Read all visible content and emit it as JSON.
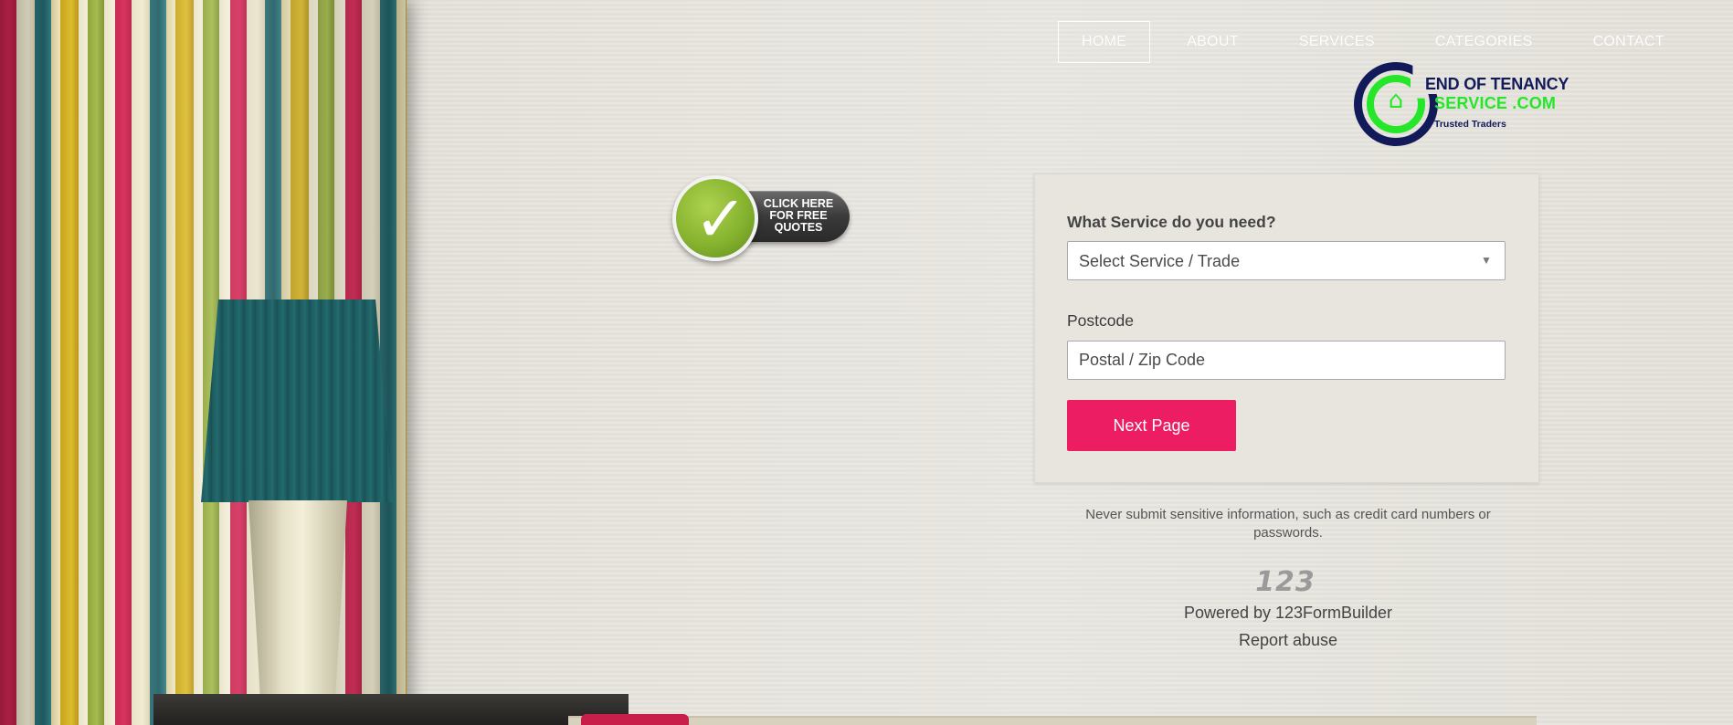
{
  "nav": {
    "items": [
      {
        "label": "HOME",
        "active": true
      },
      {
        "label": "ABOUT",
        "active": false
      },
      {
        "label": "SERVICES",
        "active": false
      },
      {
        "label": "CATEGORIES",
        "active": false
      },
      {
        "label": "CONTACT",
        "active": false
      }
    ]
  },
  "logo": {
    "line1": "END OF TENANCY",
    "line2": "SERVICE .COM",
    "line3": "Trusted Traders"
  },
  "badge": {
    "line1": "CLICK HERE",
    "line2": "FOR FREE",
    "line3": "QUOTES"
  },
  "form": {
    "service_label": "What Service do you need?",
    "service_selected": "Select Service / Trade",
    "postcode_label": "Postcode",
    "postcode_placeholder": "Postal / Zip Code",
    "postcode_value": "",
    "next_button": "Next Page"
  },
  "footer": {
    "note": "Never submit sensitive information, such as credit card numbers or passwords.",
    "logo_text": "123",
    "powered_by": "Powered by 123FormBuilder",
    "report_abuse": "Report abuse"
  },
  "colors": {
    "accent": "#ec1d63",
    "logo_navy": "#131a5a",
    "logo_green": "#26e62a",
    "badge_green": "#86b32f"
  },
  "icons": {
    "check": "check-icon",
    "dropdown": "chevron-down-icon",
    "house": "house-icon"
  }
}
